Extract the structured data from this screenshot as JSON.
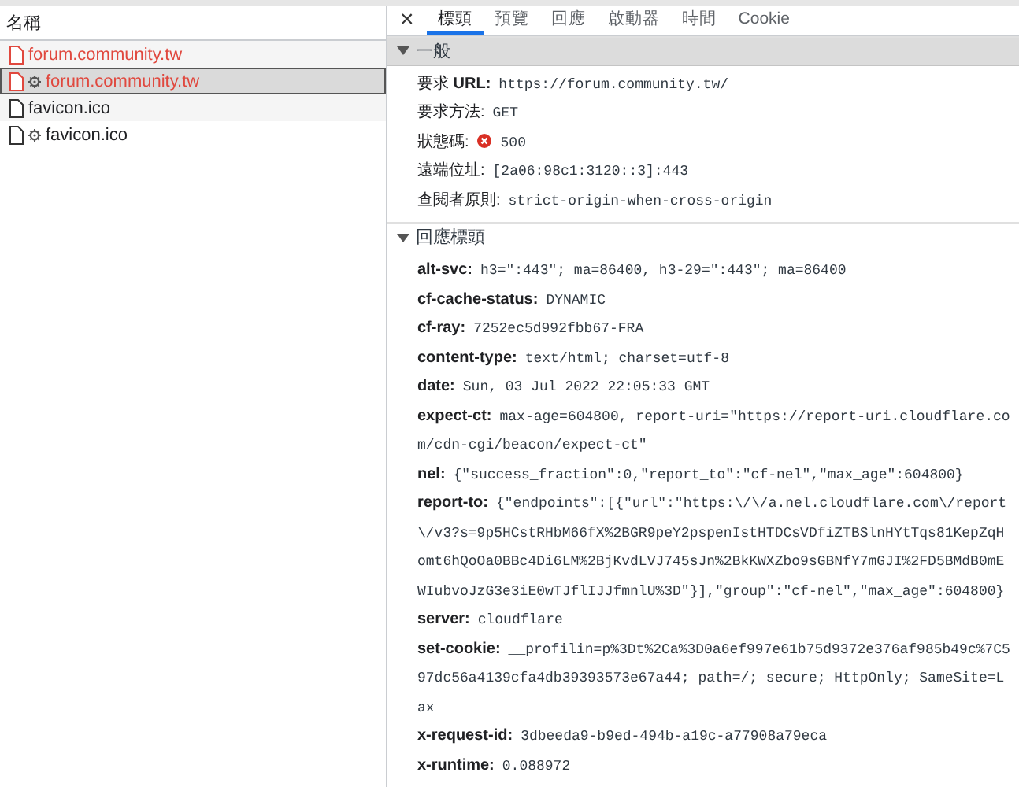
{
  "request_list": {
    "column_header": "名稱",
    "requests": [
      {
        "name": "forum.community.tw",
        "error": true,
        "selected": false,
        "service_worker": false
      },
      {
        "name": "forum.community.tw",
        "error": true,
        "selected": true,
        "service_worker": true
      },
      {
        "name": "favicon.ico",
        "error": false,
        "selected": false,
        "service_worker": false
      },
      {
        "name": "favicon.ico",
        "error": false,
        "selected": false,
        "service_worker": true
      }
    ]
  },
  "details": {
    "close": "×",
    "tabs": [
      {
        "label": "標頭",
        "selected": true
      },
      {
        "label": "預覽",
        "selected": false
      },
      {
        "label": "回應",
        "selected": false
      },
      {
        "label": "啟動器",
        "selected": false
      },
      {
        "label": "時間",
        "selected": false
      },
      {
        "label": "Cookie",
        "selected": false
      }
    ],
    "sections": [
      {
        "title": "一般",
        "expanded": true,
        "kind": "general",
        "rows": [
          {
            "label": "要求 **URL:**",
            "value": "https://forum.community.tw/",
            "error": false
          },
          {
            "label": "要求方法:",
            "value": "GET",
            "error": false
          },
          {
            "label": "狀態碼:",
            "value": "500",
            "error": true
          },
          {
            "label": "遠端位址:",
            "value": "[2a06:98c1:3120::3]:443",
            "error": false
          },
          {
            "label": "查閱者原則:",
            "value": "strict-origin-when-cross-origin",
            "error": false
          }
        ]
      },
      {
        "title": "回應標頭",
        "expanded": true,
        "kind": "headers",
        "rows": [
          {
            "label": "alt-svc:",
            "value": "h3=\":443\"; ma=86400, h3-29=\":443\"; ma=86400",
            "error": false
          },
          {
            "label": "cf-cache-status:",
            "value": "DYNAMIC",
            "error": false
          },
          {
            "label": "cf-ray:",
            "value": "7252ec5d992fbb67-FRA",
            "error": false
          },
          {
            "label": "content-type:",
            "value": "text/html; charset=utf-8",
            "error": false
          },
          {
            "label": "date:",
            "value": "Sun, 03 Jul 2022 22:05:33 GMT",
            "error": false
          },
          {
            "label": "expect-ct:",
            "value": "max-age=604800, report-uri=\"https://report-uri.cloudflare.com/cdn-cgi/beacon/expect-ct\"",
            "error": false
          },
          {
            "label": "nel:",
            "value": "{\"success_fraction\":0,\"report_to\":\"cf-nel\",\"max_age\":604800}",
            "error": false
          },
          {
            "label": "report-to:",
            "value": "{\"endpoints\":[{\"url\":\"https:\\/\\/a.nel.cloudflare.com\\/report\\/v3?s=9p5HCstRHbM66fX%2BGR9peY2pspenIstHTDCsVDfiZTBSlnHYtTqs81KepZqHomt6hQoOa0BBc4Di6LM%2BjKvdLVJ745sJn%2BkKWXZbo9sGBNfY7mGJI%2FD5BMdB0mEWIubvoJzG3e3iE0wTJflIJJfmnlU%3D\"}],\"group\":\"cf-nel\",\"max_age\":604800}",
            "error": false
          },
          {
            "label": "server:",
            "value": "cloudflare",
            "error": false
          },
          {
            "label": "set-cookie:",
            "value": "__profilin=p%3Dt%2Ca%3D0a6ef997e61b75d9372e376af985b49c%7C597dc56a4139cfa4db39393573e67a44; path=/; secure; HttpOnly; SameSite=Lax",
            "error": false
          },
          {
            "label": "x-request-id:",
            "value": "3dbeeda9-b9ed-494b-a19c-a77908a79eca",
            "error": false
          },
          {
            "label": "x-runtime:",
            "value": "0.088972",
            "error": false
          }
        ]
      }
    ]
  }
}
